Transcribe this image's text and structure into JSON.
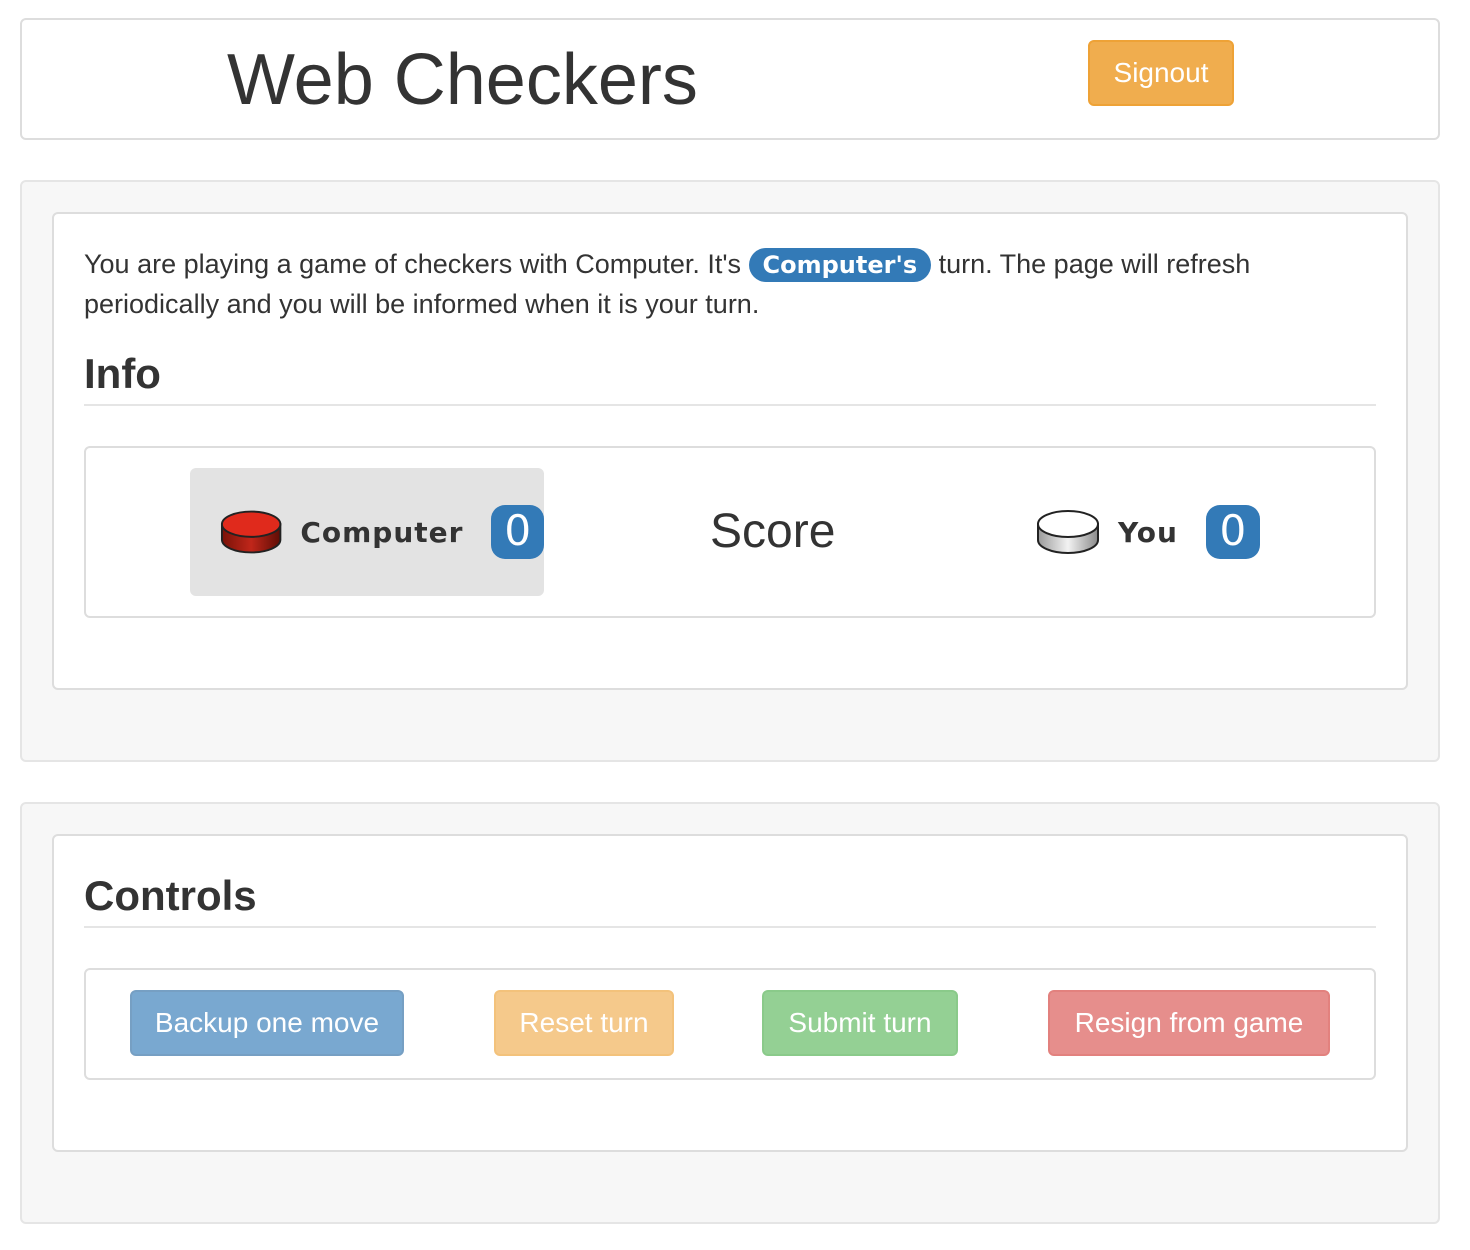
{
  "header": {
    "title": "Web Checkers",
    "signout_label": "Signout"
  },
  "game": {
    "message": {
      "before": "You are playing a game of checkers with Computer. It's ",
      "active_player": "Computer's",
      "after": " turn. The page will refresh periodically and you will be informed when it is your turn."
    },
    "info_heading": "Info",
    "score_label": "Score",
    "players": {
      "computer": {
        "name": "Computer",
        "score": "0",
        "piece_color": "red",
        "active": true
      },
      "you": {
        "name": "You",
        "score": "0",
        "piece_color": "white",
        "active": false
      }
    }
  },
  "controls": {
    "heading": "Controls",
    "backup_label": "Backup one move",
    "reset_label": "Reset turn",
    "submit_label": "Submit turn",
    "resign_label": "Resign from game"
  },
  "colors": {
    "primary": "#337ab7",
    "warning": "#f0ad4e",
    "success": "#5cb85c",
    "danger": "#d9534f"
  }
}
